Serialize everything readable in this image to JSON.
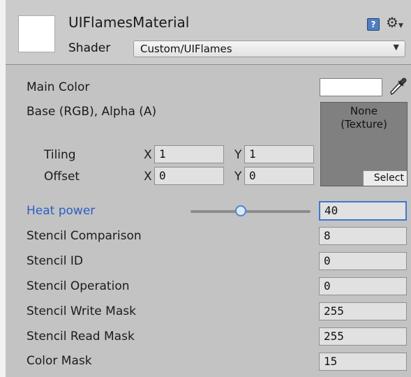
{
  "header": {
    "material_name": "UIFlamesMaterial",
    "shader_label": "Shader",
    "shader_value": "Custom/UIFlames",
    "help_icon": "help-book-icon",
    "settings_icon": "gear-icon"
  },
  "properties": {
    "main_color": {
      "label": "Main Color",
      "value": "#ffffff",
      "picker_icon": "eyedropper-icon"
    },
    "base_texture": {
      "label": "Base (RGB), Alpha (A)",
      "tiling_label": "Tiling",
      "offset_label": "Offset",
      "x_label": "X",
      "y_label": "Y",
      "tiling_x": "1",
      "tiling_y": "1",
      "offset_x": "0",
      "offset_y": "0",
      "slot_text": "None\n(Texture)",
      "select_label": "Select"
    },
    "heat_power": {
      "label": "Heat power",
      "value": "40",
      "slider_fraction": 0.42,
      "label_color": "#2b5fc4"
    },
    "stencil_comparison": {
      "label": "Stencil Comparison",
      "value": "8"
    },
    "stencil_id": {
      "label": "Stencil ID",
      "value": "0"
    },
    "stencil_operation": {
      "label": "Stencil Operation",
      "value": "0"
    },
    "stencil_write_mask": {
      "label": "Stencil Write Mask",
      "value": "255"
    },
    "stencil_read_mask": {
      "label": "Stencil Read Mask",
      "value": "255"
    },
    "color_mask": {
      "label": "Color Mask",
      "value": "15"
    }
  }
}
